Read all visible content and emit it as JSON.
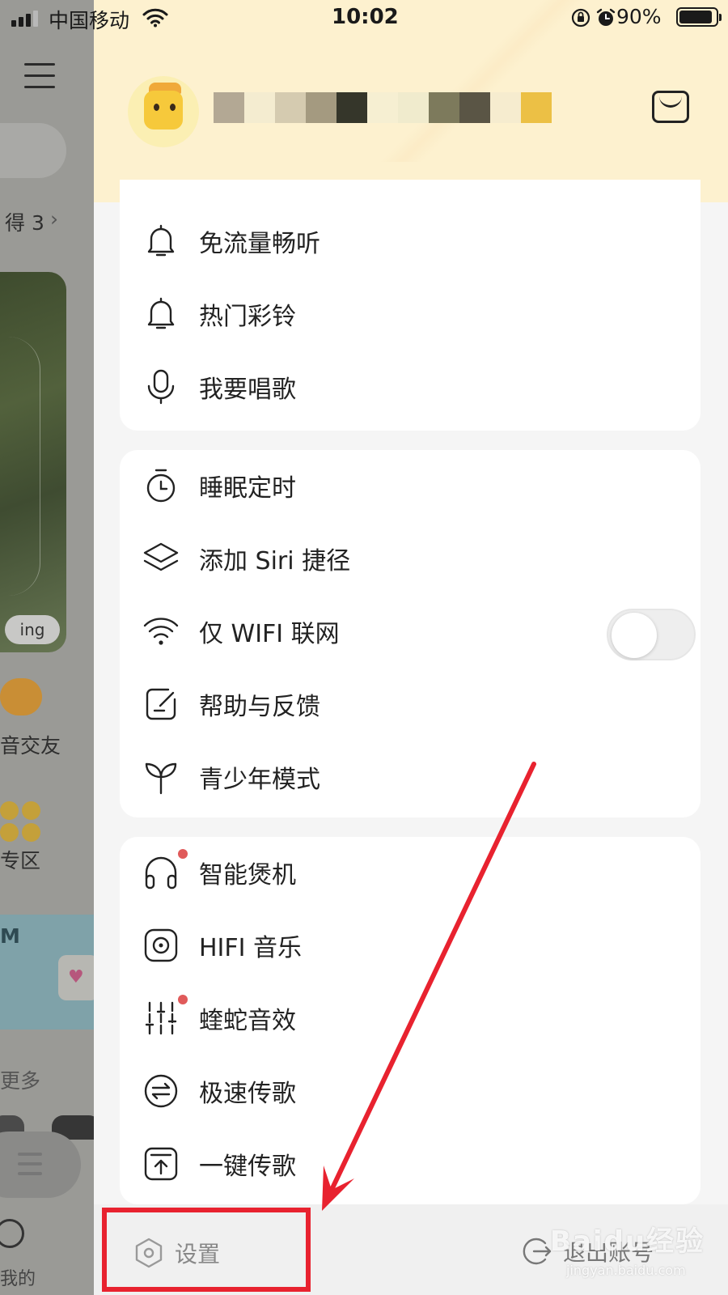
{
  "status_bar": {
    "carrier": "中国移动",
    "time": "10:02",
    "battery_percent": "90%",
    "battery_level": 0.9
  },
  "background_app": {
    "label_get": "得 3",
    "tag_playing": "ing",
    "label_voice_friends": "音交友",
    "label_zone": "专区",
    "label_m": "M",
    "label_more": "更多",
    "label_mine": "我的"
  },
  "drawer": {
    "header": {
      "mail_icon": "mail-icon"
    },
    "card1": {
      "items": [
        {
          "label": "免流量畅听",
          "icon": "bell-icon"
        },
        {
          "label": "热门彩铃",
          "icon": "bell-icon"
        },
        {
          "label": "我要唱歌",
          "icon": "microphone-icon"
        }
      ]
    },
    "card2": {
      "items": [
        {
          "label": "睡眠定时",
          "icon": "timer-icon"
        },
        {
          "label": "添加 Siri 捷径",
          "icon": "layers-icon"
        },
        {
          "label": "仅 WIFI 联网",
          "icon": "wifi-icon",
          "toggle_on": false
        },
        {
          "label": "帮助与反馈",
          "icon": "feedback-icon"
        },
        {
          "label": "青少年模式",
          "icon": "sprout-icon"
        }
      ]
    },
    "card3": {
      "items": [
        {
          "label": "智能煲机",
          "icon": "headphones-icon",
          "badge_dot": true
        },
        {
          "label": "HIFI 音乐",
          "icon": "hifi-icon"
        },
        {
          "label": "蝰蛇音效",
          "icon": "equalizer-icon",
          "badge_dot": true
        },
        {
          "label": "极速传歌",
          "icon": "transfer-icon"
        },
        {
          "label": "一键传歌",
          "icon": "upload-icon"
        }
      ]
    },
    "footer": {
      "settings_label": "设置",
      "logout_label": "退出账号"
    }
  },
  "annotation": {
    "highlight_color": "#e8222f",
    "watermark": "Baidu经验",
    "watermark_url": "jingyan.baidu.com"
  }
}
